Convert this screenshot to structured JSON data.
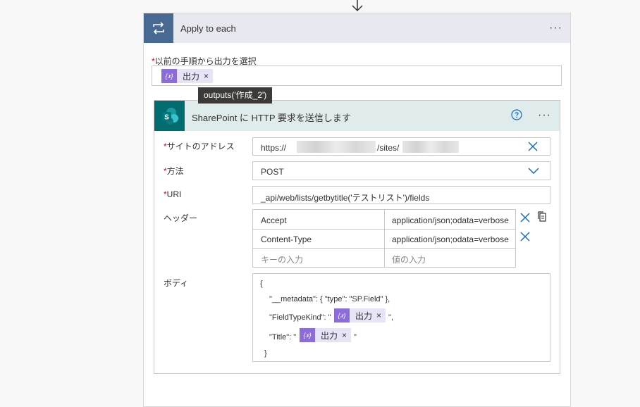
{
  "loop": {
    "title": "Apply to each",
    "more": "···",
    "select_label": "以前の手順から出力を選択",
    "required_mark": "*",
    "token_icon": "{𝑥}",
    "token_label": "出力",
    "token_remove": "×",
    "tooltip": "outputs('作成_2')"
  },
  "action": {
    "title": "SharePoint に HTTP 要求を送信します",
    "more": "···",
    "badge_letter": "S",
    "fields": {
      "site": {
        "label": "サイトのアドレス",
        "prefix": "https://",
        "suffix": "/sites/"
      },
      "method": {
        "label": "方法",
        "value": "POST"
      },
      "uri": {
        "label": "URI",
        "value": "_api/web/lists/getbytitle('テストリスト')/fields"
      },
      "headers": {
        "label": "ヘッダー",
        "rows": [
          {
            "key": "Accept",
            "value": "application/json;odata=verbose"
          },
          {
            "key": "Content-Type",
            "value": "application/json;odata=verbose"
          }
        ],
        "key_placeholder": "キーの入力",
        "value_placeholder": "値の入力"
      },
      "body": {
        "label": "ボディ",
        "line1": "{",
        "line2": "\"__metadata\": { \"type\": \"SP.Field\" },",
        "line3_prefix": "\"FieldTypeKind\": \"",
        "line3_suffix": "\",",
        "line4_prefix": "\"Title\": \"",
        "line4_suffix": "\"",
        "line5": "}"
      }
    }
  },
  "colors": {
    "loop_badge": "#486991",
    "sharepoint_badge": "#036c70",
    "token": "#8c6cd8",
    "link_blue": "#0f6cbd"
  }
}
